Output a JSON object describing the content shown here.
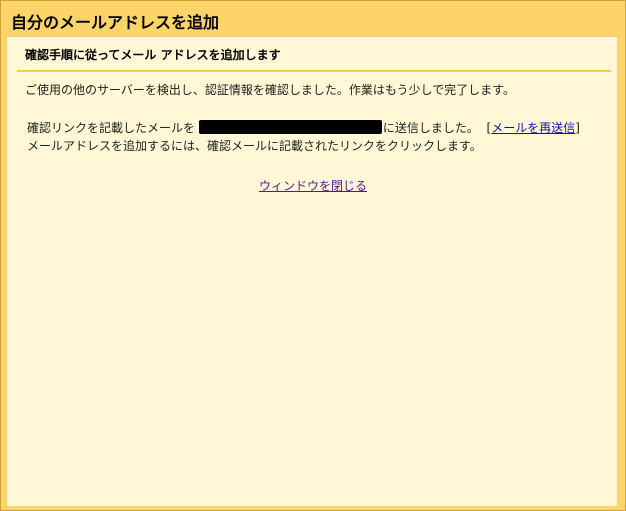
{
  "window": {
    "title": "自分のメールアドレスを追加"
  },
  "content": {
    "heading": "確認手順に従ってメール アドレスを追加します",
    "paragraph1": "ご使用の他のサーバーを検出し、認証情報を確認しました。作業はもう少しで完了します。",
    "paragraph2_prefix": "確認リンクを記載したメールを",
    "paragraph2_suffix": "に送信しました。",
    "bracket_open": "[",
    "bracket_close": "]",
    "resend_link": "メールを再送信",
    "paragraph3": "メールアドレスを追加するには、確認メールに記載されたリンクをクリックします。",
    "close_link": "ウィンドウを閉じる"
  },
  "colors": {
    "title_bar": "#fcd46a",
    "content_bg": "#fff7d6",
    "divider": "#f5c94d",
    "link": "#1a0dab",
    "visited_link": "#551a8b"
  }
}
